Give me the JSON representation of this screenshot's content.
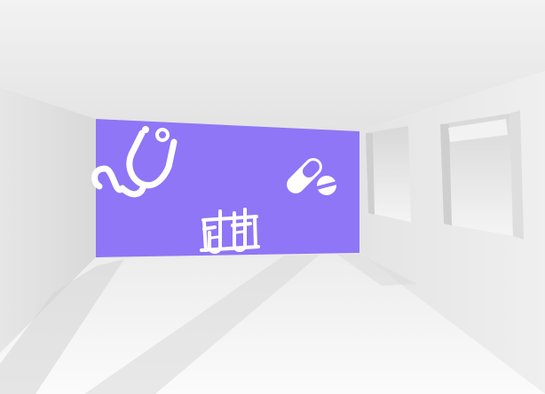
{
  "scene": {
    "subject": "white-room-with-medical-billboard",
    "colors": {
      "billboard": "#8E76F6",
      "icon": "#FFFFFF",
      "wall": "#EDEDED",
      "floor": "#F5F5F5",
      "ceiling": "#EFEFEF",
      "shadow": "#D7D7D7"
    },
    "icons": [
      "stethoscope-icon",
      "pill-capsule-icon",
      "test-tubes-icon"
    ]
  }
}
